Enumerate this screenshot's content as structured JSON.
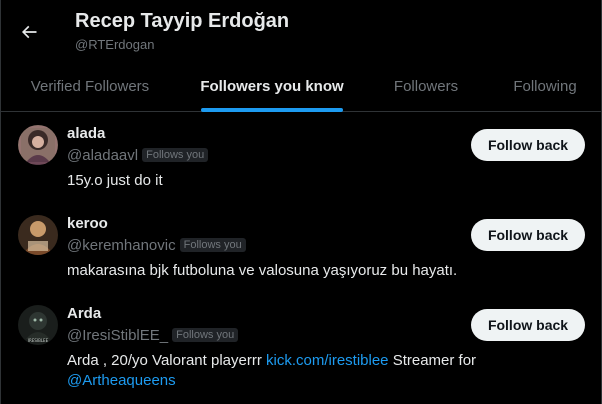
{
  "header": {
    "title": "Recep Tayyip Erdoğan",
    "handle": "@RTErdogan"
  },
  "tabs": [
    {
      "label": "Verified Followers",
      "active": false
    },
    {
      "label": "Followers you know",
      "active": true
    },
    {
      "label": "Followers",
      "active": false
    },
    {
      "label": "Following",
      "active": false
    }
  ],
  "users": [
    {
      "name": "alada",
      "handle": "@aladaavl",
      "badge": "Follows you",
      "bio": "15y.o just do it",
      "button": "Follow back"
    },
    {
      "name": "keroo",
      "handle": "@keremhanovic",
      "badge": "Follows you",
      "bio": "makarasına bjk futboluna ve valosuna yaşıyoruz bu hayatı.",
      "button": "Follow back"
    },
    {
      "name": "Arda",
      "handle": "@IresiStiblEE_",
      "badge": "Follows you",
      "bio_prefix": "Arda , 20/yo Valorant playerrr ",
      "bio_link": "kick.com/irestiblee",
      "bio_mid": " Streamer for",
      "bio_mention": "@Artheaqueens",
      "avatar_text": "IRESIBLEE",
      "button": "Follow back"
    }
  ],
  "colors": {
    "background": "#000000",
    "accent": "#1d9bf0",
    "muted": "#71767b",
    "text": "#e7e9ea",
    "button_bg": "#eff3f4"
  }
}
